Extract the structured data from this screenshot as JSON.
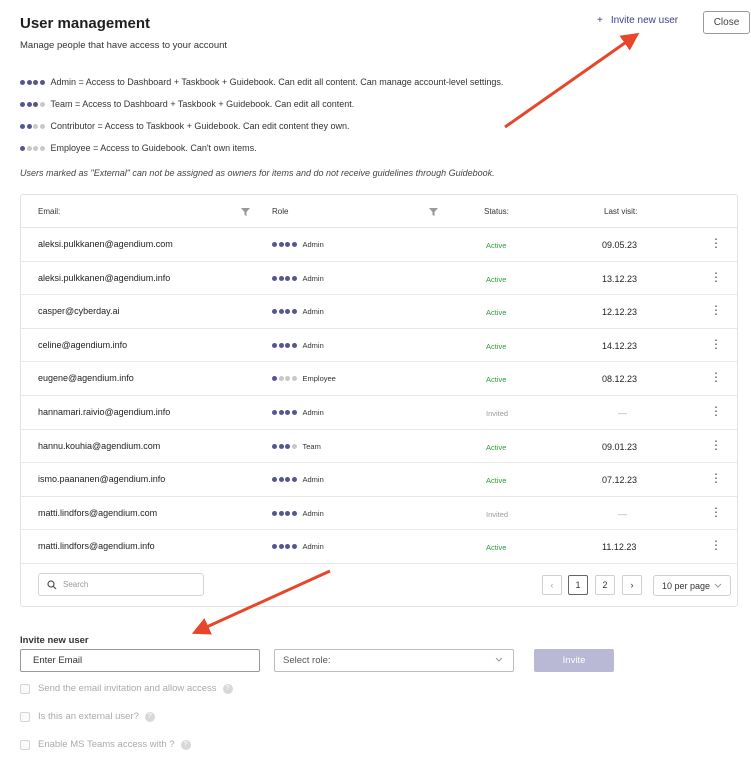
{
  "header": {
    "title": "User management",
    "subtitle": "Manage people that have access to your account",
    "invite_link_icon": "+",
    "invite_link_label": "Invite new user",
    "close_label": "Close"
  },
  "legend": [
    {
      "level": 4,
      "text": "Admin = Access to Dashboard + Taskbook + Guidebook. Can edit all content. Can manage account-level settings."
    },
    {
      "level": 3,
      "text": "Team = Access to Dashboard + Taskbook + Guidebook. Can edit all content."
    },
    {
      "level": 2,
      "text": "Contributor = Access to Taskbook + Guidebook. Can edit content they own."
    },
    {
      "level": 1,
      "text": "Employee = Access to Guidebook. Can't own items."
    }
  ],
  "note": "Users marked as \"External\" can not be assigned as owners for items and do not receive guidelines through Guidebook.",
  "table": {
    "columns": {
      "email": "Email:",
      "role": "Role",
      "status": "Status:",
      "last_visit": "Last visit:"
    },
    "rows": [
      {
        "email": "aleksi.pulkkanen@agendium.com",
        "role": "Admin",
        "level": 4,
        "status": "Active",
        "last_visit": "09.05.23"
      },
      {
        "email": "aleksi.pulkkanen@agendium.info",
        "role": "Admin",
        "level": 4,
        "status": "Active",
        "last_visit": "13.12.23"
      },
      {
        "email": "casper@cyberday.ai",
        "role": "Admin",
        "level": 4,
        "status": "Active",
        "last_visit": "12.12.23"
      },
      {
        "email": "celine@agendium.info",
        "role": "Admin",
        "level": 4,
        "status": "Active",
        "last_visit": "14.12.23"
      },
      {
        "email": "eugene@agendium.info",
        "role": "Employee",
        "level": 1,
        "status": "Active",
        "last_visit": "08.12.23"
      },
      {
        "email": "hannamari.raivio@agendium.info",
        "role": "Admin",
        "level": 4,
        "status": "Invited",
        "last_visit": "—"
      },
      {
        "email": "hannu.kouhia@agendium.com",
        "role": "Team",
        "level": 3,
        "status": "Active",
        "last_visit": "09.01.23"
      },
      {
        "email": "ismo.paananen@agendium.info",
        "role": "Admin",
        "level": 4,
        "status": "Active",
        "last_visit": "07.12.23"
      },
      {
        "email": "matti.lindfors@agendium.com",
        "role": "Admin",
        "level": 4,
        "status": "Invited",
        "last_visit": "—"
      },
      {
        "email": "matti.lindfors@agendium.info",
        "role": "Admin",
        "level": 4,
        "status": "Active",
        "last_visit": "11.12.23"
      }
    ],
    "row_menu_icon": "⋮",
    "search_placeholder": "Search",
    "pagination": {
      "prev": "‹",
      "pages": [
        "1",
        "2"
      ],
      "current": "1",
      "next": "›",
      "per_page": "10 per page"
    }
  },
  "invite_form": {
    "label": "Invite new user",
    "email_placeholder": "Enter Email",
    "role_placeholder": "Select role:",
    "invite_button": "Invite",
    "options": [
      {
        "label": "Send the email invitation and allow access"
      },
      {
        "label": "Is this an external user?"
      },
      {
        "label": "Enable MS Teams access with ?"
      }
    ],
    "help_icon": "?"
  },
  "colors": {
    "accent": "#55558f",
    "active": "#2e9e3a",
    "arrow": "#e8462a",
    "button_disabled": "#b9b9d6"
  }
}
